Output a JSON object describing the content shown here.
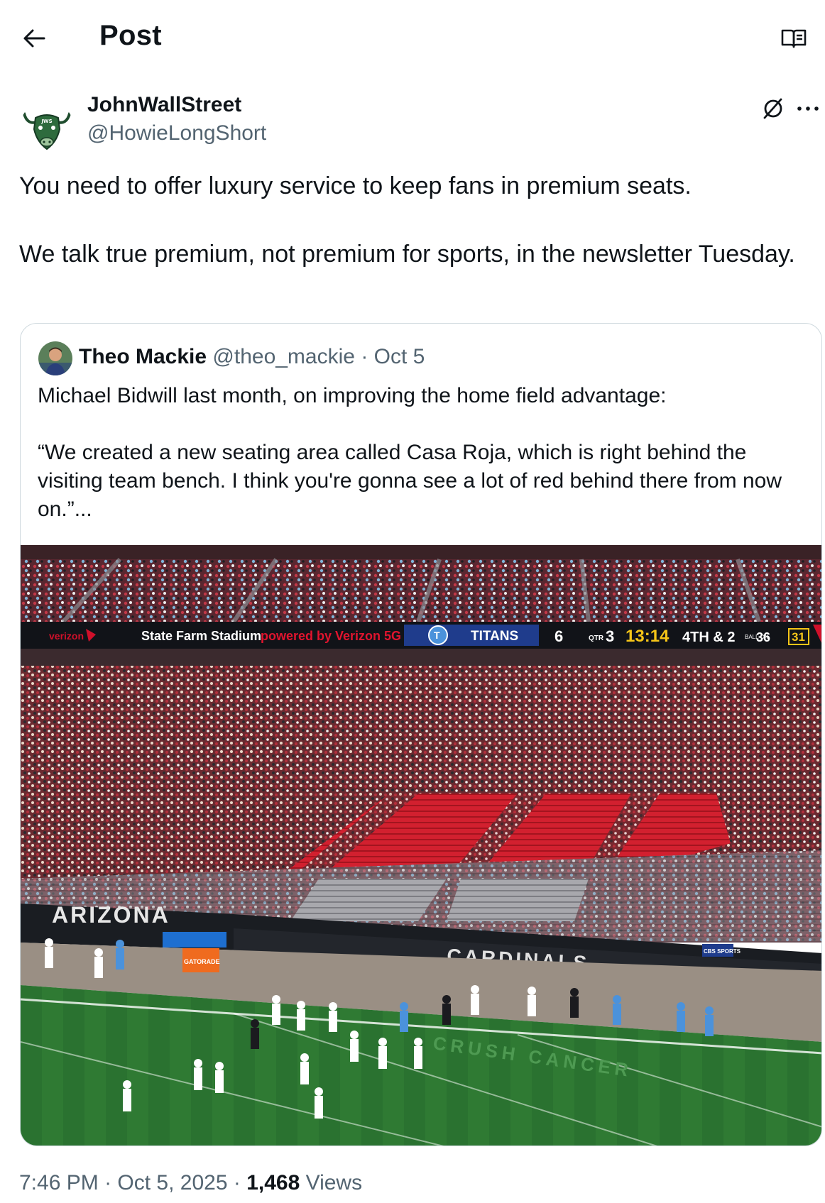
{
  "header": {
    "title": "Post",
    "back_icon": "arrow-left-icon",
    "reader_icon": "open-book-icon"
  },
  "author": {
    "name": "JohnWallStreet",
    "handle": "@HowieLongShort",
    "avatar_icon": "bull-logo-icon",
    "avatar_logo_text": "JWS"
  },
  "actions": {
    "grok_icon": "slashed-circle-icon",
    "more_icon": "more-horizontal-icon"
  },
  "tweet": {
    "paragraph_1": "You need to offer luxury service to keep fans in premium seats.",
    "paragraph_2": "We talk true premium, not premium for sports, in the newsletter Tuesday."
  },
  "quote": {
    "name": "Theo Mackie",
    "handle": "@theo_mackie",
    "separator": "·",
    "date": "Oct 5",
    "paragraph_1": "Michael Bidwill last month, on improving the home field advantage:",
    "paragraph_2": "“We created a new seating area called Casa Roja, which is right behind the visiting team bench. I think you're gonna see a lot of red behind there from now on.”...",
    "media": {
      "ribbon_left": "State Farm Stadium",
      "ribbon_powered": "powered by Verizon 5G",
      "ribbon_brand": "verizon",
      "team_name": "TITANS",
      "team_score": "6",
      "quarter_label": "QTR",
      "quarter": "3",
      "clock": "13:14",
      "down_distance": "4TH & 2",
      "ball_on_label": "BALL ON",
      "ball_on": "36",
      "play_clock": "31",
      "wall_text": "ARIZONA",
      "lower_wall_text": "CARDINALS",
      "sideline_sign": "GATORADE",
      "broadcast_tag": "CBS SPORTS",
      "field_text": "CRUSH CANCER"
    }
  },
  "meta": {
    "time": "7:46 PM",
    "sep1": " · ",
    "date": "Oct 5, 2025",
    "sep2": " · ",
    "views_count": "1,468",
    "views_label": " Views"
  },
  "colors": {
    "text": "#0f1419",
    "secondary": "#536471",
    "border": "#cfd9de",
    "cardinals_red": "#c8102e",
    "titans_blue": "#1f3c8c",
    "field_green": "#2f7a33"
  }
}
